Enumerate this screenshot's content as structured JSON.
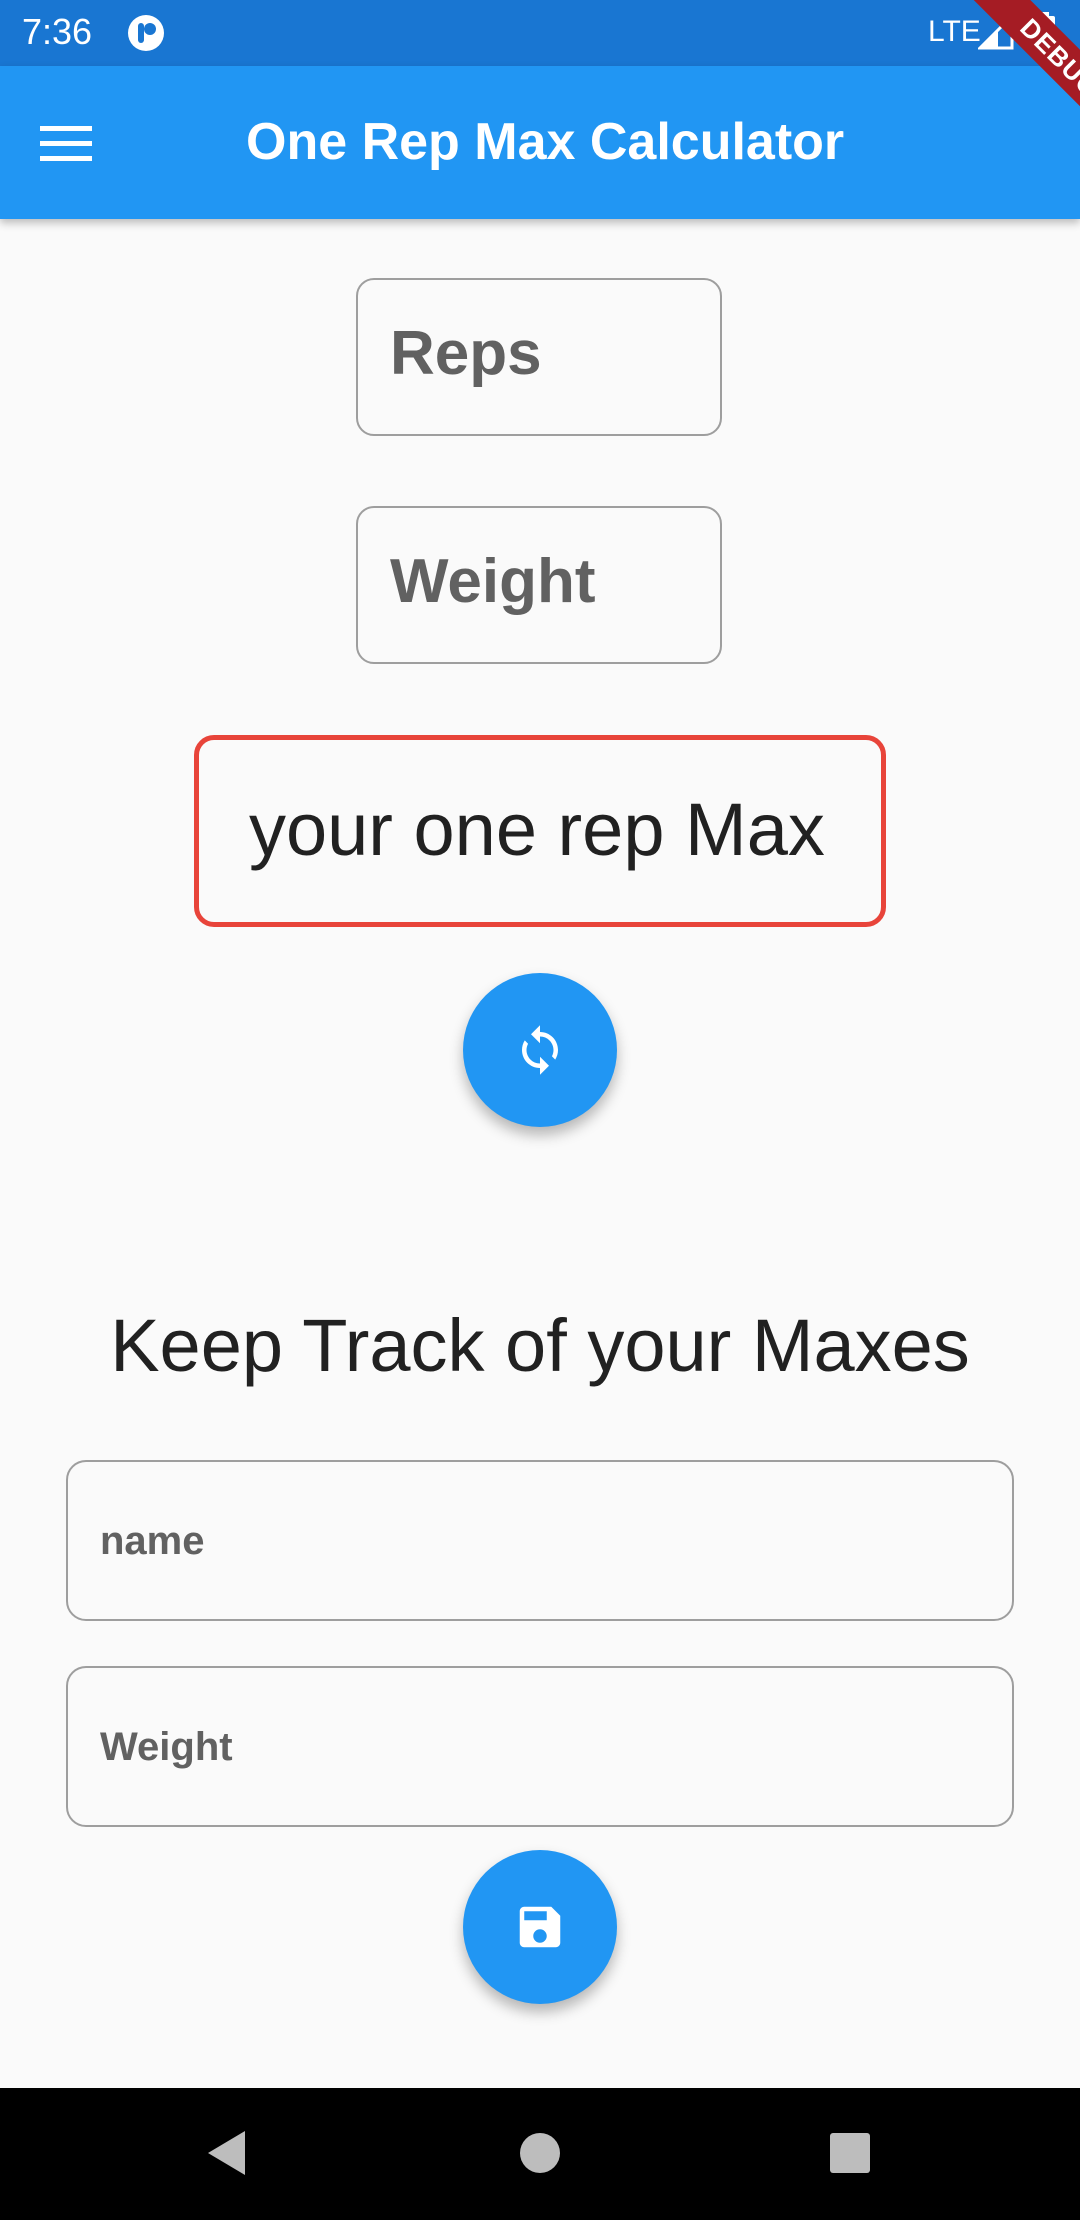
{
  "status_bar": {
    "time": "7:36",
    "network": "LTE",
    "icons": [
      "app-notification-icon",
      "signal-icon",
      "battery-icon"
    ]
  },
  "app_bar": {
    "title": "One Rep Max Calculator",
    "menu_icon": "hamburger-menu-icon",
    "debug_label": "DEBUG",
    "color": "#2196f3"
  },
  "calculator": {
    "reps_placeholder": "Reps",
    "weight_placeholder": "Weight",
    "result_text": "your one rep Max",
    "result_border_color": "#e8443a",
    "calculate_icon": "refresh-icon"
  },
  "tracker": {
    "heading": "Keep Track of your Maxes",
    "name_placeholder": "name",
    "weight_placeholder": "Weight",
    "save_icon": "save-icon"
  },
  "nav_bar": {
    "icons": [
      "back-icon",
      "home-icon",
      "recents-icon"
    ]
  }
}
